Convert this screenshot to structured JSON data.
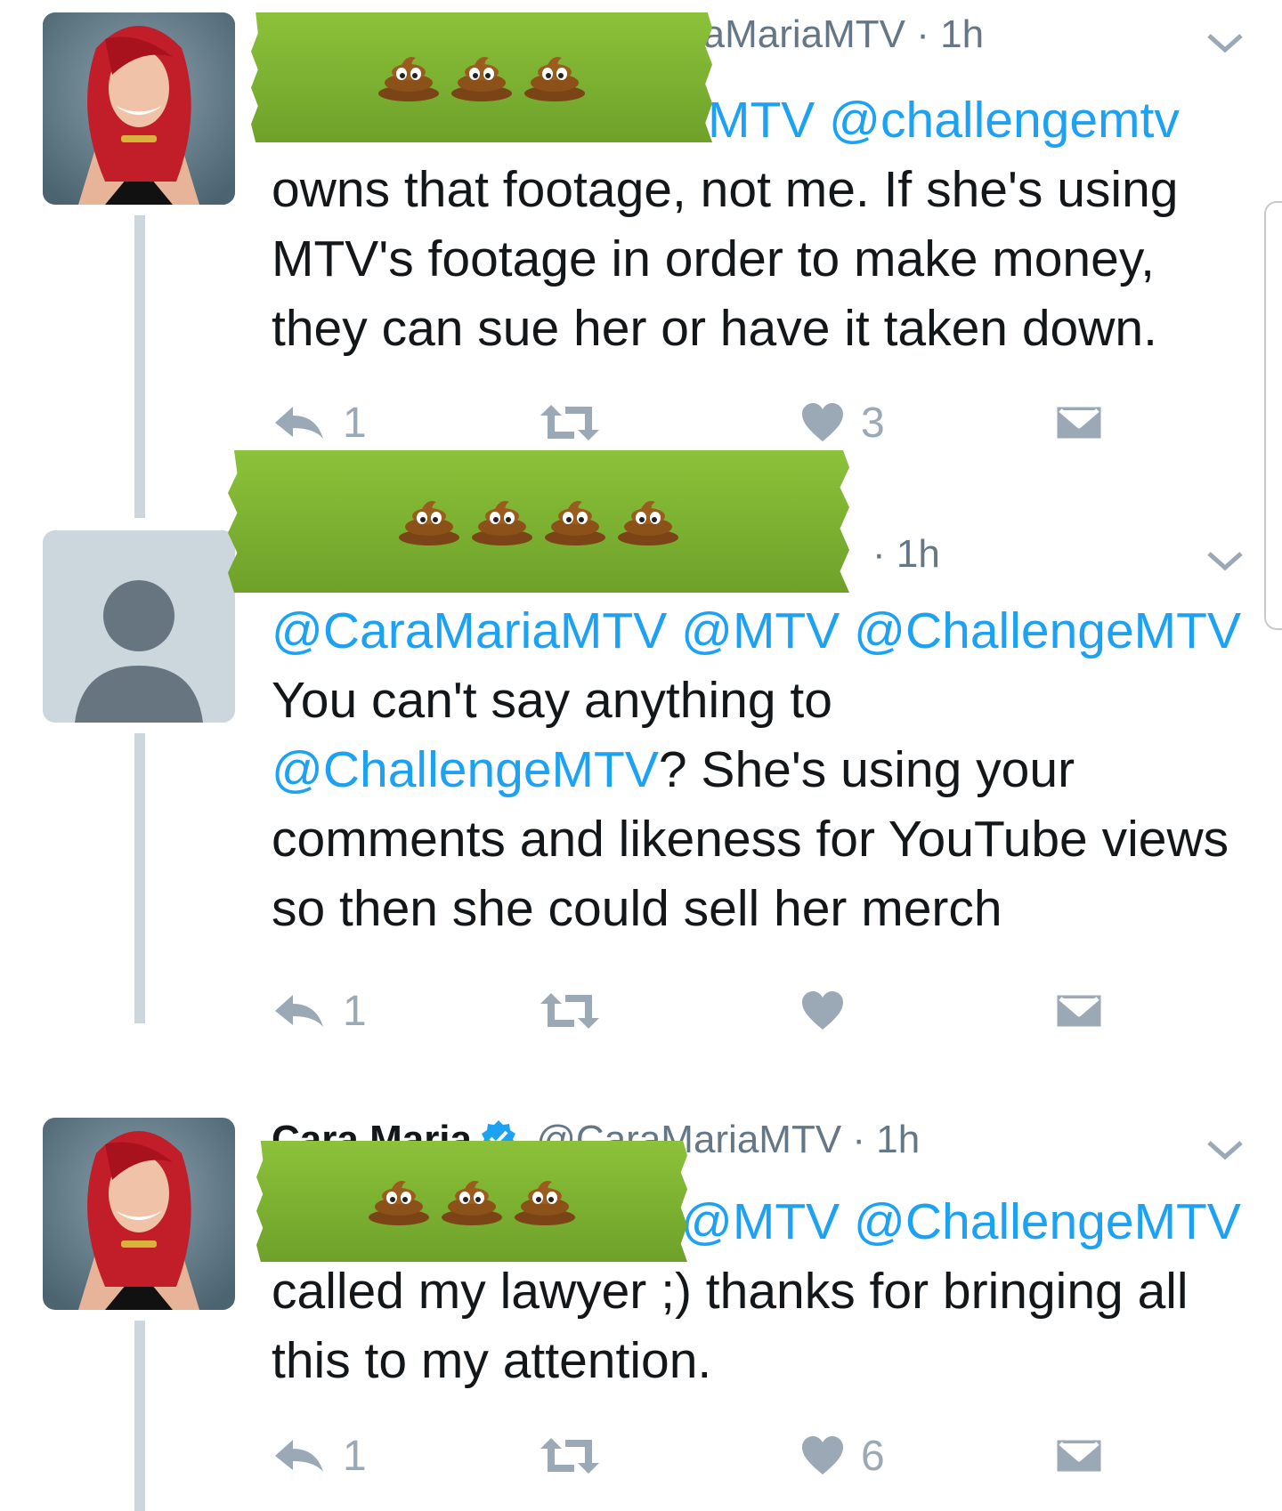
{
  "tweets": [
    {
      "header_handle": "raMariaMTV",
      "header_time": "· 1h",
      "body": [
        {
          "text": "MTV @challengemtv",
          "type": "mention"
        },
        {
          "text": " owns that footage, not me. If she's using MTV's footage in order to make money, they can sue her or have it taken down.",
          "type": "text"
        }
      ],
      "actions": {
        "reply_count": "1",
        "retweet_count": "",
        "like_count": "3"
      },
      "avatar": "profile-photo",
      "redaction": {
        "emoji_count": 3
      }
    },
    {
      "header_time": "· 1h",
      "body": [
        {
          "text": "@CaraMariaMTV @MTV @ChallengeMTV",
          "type": "mention"
        },
        {
          "text": " You can't say anything to ",
          "type": "text"
        },
        {
          "text": "@ChallengeMTV",
          "type": "mention"
        },
        {
          "text": "? She's using your comments and likeness for YouTube views so then she could sell her merch",
          "type": "text"
        }
      ],
      "actions": {
        "reply_count": "1",
        "retweet_count": "",
        "like_count": ""
      },
      "avatar": "default-avatar",
      "redaction": {
        "emoji_count": 4
      }
    },
    {
      "header_name": "Cara Maria",
      "header_handle": "@CaraMariaMTV",
      "header_time": "· 1h",
      "body": [
        {
          "text": "@MTV @ChallengeMTV",
          "type": "mention"
        },
        {
          "text": " called my lawyer ;) thanks for bringing all this to my attention.",
          "type": "text"
        }
      ],
      "actions": {
        "reply_count": "1",
        "retweet_count": "",
        "like_count": "6"
      },
      "avatar": "profile-photo",
      "redaction": {
        "emoji_count": 3
      }
    }
  ],
  "colors": {
    "link": "#1da1f2",
    "text": "#14171a",
    "meta": "#657786",
    "action_icon": "#9aa9b5",
    "thread_line": "#ccd6dd",
    "redaction_tape": "#7bb031"
  },
  "icons": [
    "reply-icon",
    "retweet-icon",
    "like-icon",
    "direct-message-icon",
    "chevron-down-icon",
    "verified-badge-icon",
    "poop-emoji-icon"
  ]
}
